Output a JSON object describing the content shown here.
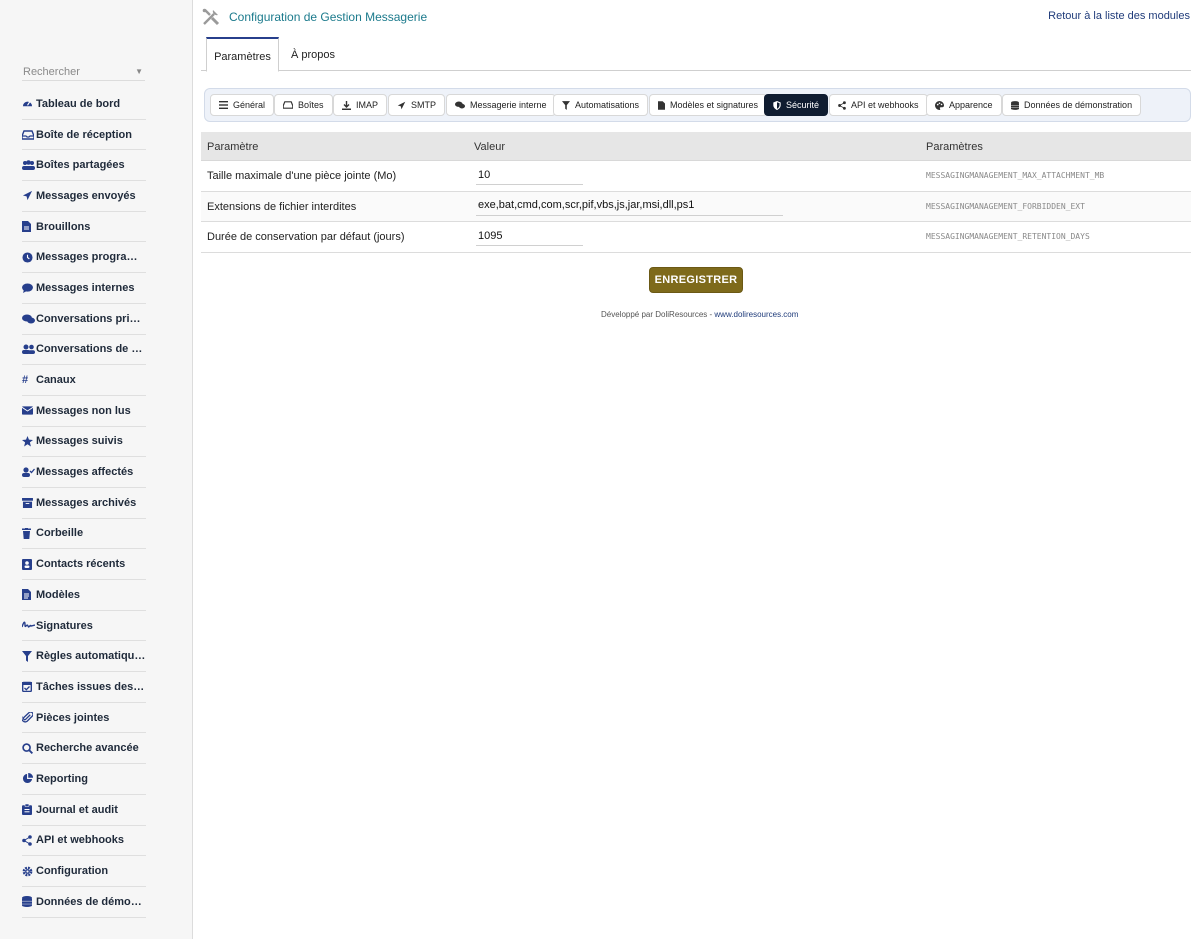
{
  "sidebar": {
    "search_placeholder": "Rechercher",
    "items": [
      {
        "label": "Tableau de bord",
        "icon": "dashboard-icon"
      },
      {
        "label": "Boîte de réception",
        "icon": "inbox-icon"
      },
      {
        "label": "Boîtes partagées",
        "icon": "users-icon"
      },
      {
        "label": "Messages envoyés",
        "icon": "paper-plane-icon"
      },
      {
        "label": "Brouillons",
        "icon": "file-icon"
      },
      {
        "label": "Messages programm…",
        "icon": "clock-icon"
      },
      {
        "label": "Messages internes",
        "icon": "comment-icon"
      },
      {
        "label": "Conversations privées",
        "icon": "comments-icon"
      },
      {
        "label": "Conversations de gr…",
        "icon": "user-group-icon"
      },
      {
        "label": "Canaux",
        "icon": "hashtag-icon"
      },
      {
        "label": "Messages non lus",
        "icon": "envelope-icon"
      },
      {
        "label": "Messages suivis",
        "icon": "star-icon"
      },
      {
        "label": "Messages affectés",
        "icon": "user-check-icon"
      },
      {
        "label": "Messages archivés",
        "icon": "archive-icon"
      },
      {
        "label": "Corbeille",
        "icon": "trash-icon"
      },
      {
        "label": "Contacts récents",
        "icon": "address-book-icon"
      },
      {
        "label": "Modèles",
        "icon": "file-alt-icon"
      },
      {
        "label": "Signatures",
        "icon": "signature-icon"
      },
      {
        "label": "Règles automatiques",
        "icon": "filter-icon"
      },
      {
        "label": "Tâches issues des …",
        "icon": "tasks-icon"
      },
      {
        "label": "Pièces jointes",
        "icon": "paperclip-icon"
      },
      {
        "label": "Recherche avancée",
        "icon": "search-icon"
      },
      {
        "label": "Reporting",
        "icon": "chart-pie-icon"
      },
      {
        "label": "Journal et audit",
        "icon": "clipboard-icon"
      },
      {
        "label": "API et webhooks",
        "icon": "share-icon"
      },
      {
        "label": "Configuration",
        "icon": "gear-icon"
      },
      {
        "label": "Données de démons…",
        "icon": "database-icon"
      }
    ]
  },
  "header": {
    "title": "Configuration de Gestion Messagerie",
    "back_link": "Retour à la liste des modules"
  },
  "tabs": [
    {
      "label": "Paramètres",
      "active": true
    },
    {
      "label": "À propos",
      "active": false
    }
  ],
  "subtabs": [
    {
      "label": "Général",
      "icon": "bars-icon"
    },
    {
      "label": "Boîtes",
      "icon": "inbox-icon"
    },
    {
      "label": "IMAP",
      "icon": "download-icon"
    },
    {
      "label": "SMTP",
      "icon": "paper-plane-icon"
    },
    {
      "label": "Messagerie interne",
      "icon": "comments-icon"
    },
    {
      "label": "Automatisations",
      "icon": "filter-icon"
    },
    {
      "label": "Modèles et signatures",
      "icon": "file-icon"
    },
    {
      "label": "Sécurité",
      "icon": "shield-icon",
      "active": true
    },
    {
      "label": "API et webhooks",
      "icon": "share-icon"
    },
    {
      "label": "Apparence",
      "icon": "palette-icon"
    },
    {
      "label": "Données de démonstration",
      "icon": "database-icon"
    }
  ],
  "table": {
    "headers": [
      "Paramètre",
      "Valeur",
      "Paramètres"
    ],
    "rows": [
      {
        "name": "Taille maximale d'une pièce jointe (Mo)",
        "value": "10",
        "key": "MESSAGINGMANAGEMENT_MAX_ATTACHMENT_MB"
      },
      {
        "name": "Extensions de fichier interdites",
        "value": "exe,bat,cmd,com,scr,pif,vbs,js,jar,msi,dll,ps1",
        "key": "MESSAGINGMANAGEMENT_FORBIDDEN_EXT"
      },
      {
        "name": "Durée de conservation par défaut (jours)",
        "value": "1095",
        "key": "MESSAGINGMANAGEMENT_RETENTION_DAYS"
      }
    ]
  },
  "save_button": "ENREGISTRER",
  "footer": {
    "prefix": "Développé par DoliResources - ",
    "link": "www.doliresources.com"
  },
  "colors": {
    "accent": "#273f8c",
    "title": "#1b7a8c",
    "save_button": "#7e6a1b",
    "active_subtab": "#0f1c30"
  }
}
